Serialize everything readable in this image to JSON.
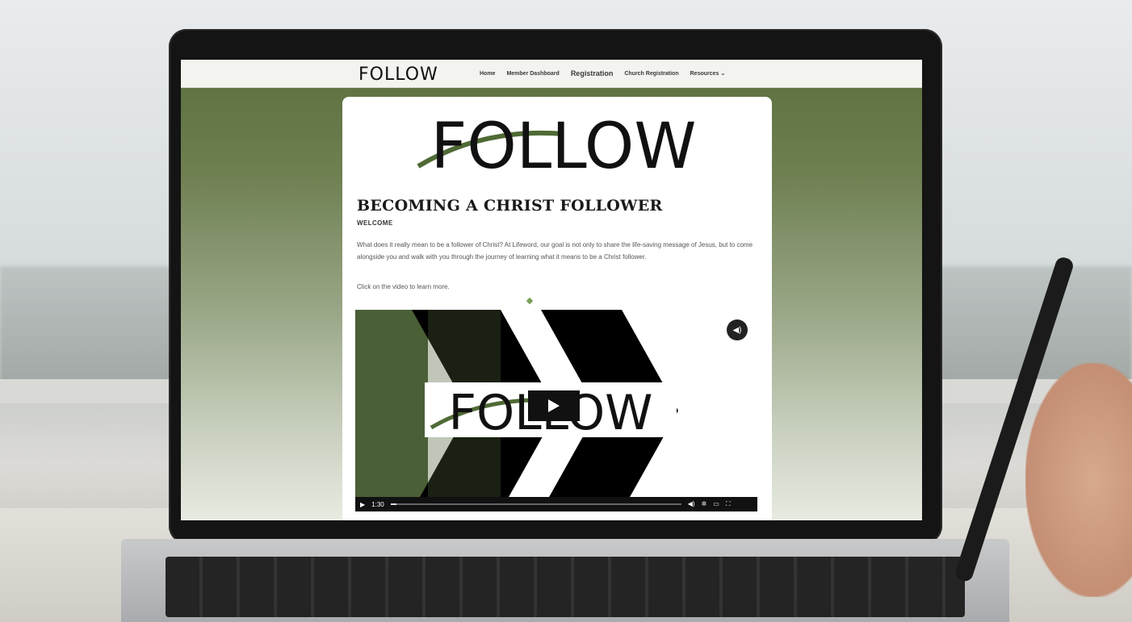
{
  "nav": {
    "logo": "FOLLOW",
    "links": [
      {
        "label": "Home"
      },
      {
        "label": "Member Dashboard"
      },
      {
        "label": "Registration"
      },
      {
        "label": "Church Registration"
      },
      {
        "label": "Resources ⌄"
      }
    ]
  },
  "hero": {
    "logo_text": "FOLLOW"
  },
  "content": {
    "title": "BECOMING A CHRIST FOLLOWER",
    "subtitle": "WELCOME",
    "paragraph": "What does it really mean to be a follower of Christ? At Lifeword, our goal is not only to share the life-saving message of Jesus, but to come alongside you and walk with you through the journey of learning what it means to be a Christ follower.",
    "cta": "Click on the video to learn more."
  },
  "video": {
    "logo_text": "FOLLOW",
    "time": "1:30",
    "progress": 0.02,
    "icons": [
      "play-icon",
      "volume-icon",
      "settings-icon",
      "airplay-icon",
      "fullscreen-icon",
      "mute-icon"
    ]
  },
  "colors": {
    "accent_green": "#5b6f3e",
    "nav_bg": "#f3f4f0",
    "text_dark": "#1a1a1a"
  }
}
